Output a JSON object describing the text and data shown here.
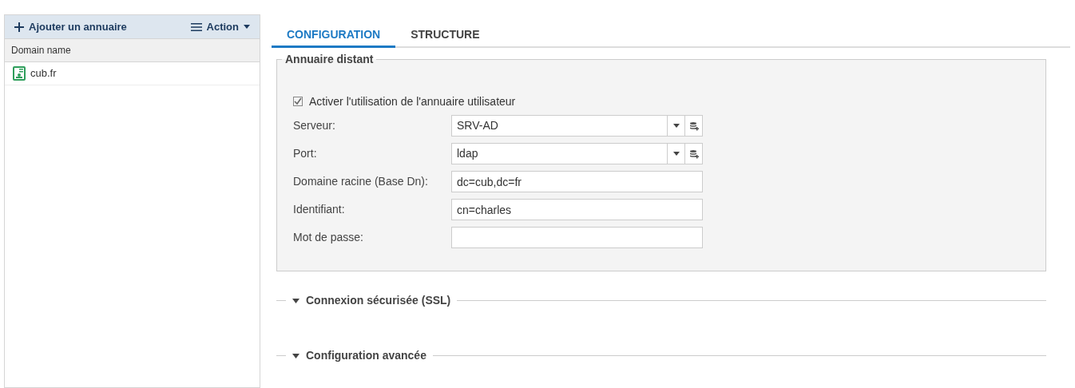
{
  "sidebar": {
    "toolbar": {
      "add_button": "Ajouter un annuaire",
      "action_button": "Action"
    },
    "column": "Domain name",
    "rows": [
      {
        "label": "cub.fr",
        "selected": false
      }
    ]
  },
  "tabs": [
    {
      "label": "CONFIGURATION",
      "selected": true
    },
    {
      "label": "STRUCTURE",
      "selected": false
    }
  ],
  "fieldset": {
    "legend": "Annuaire distant",
    "checkbox": {
      "label": "Activer l'utilisation de l'annuaire utilisateur",
      "checked": true
    },
    "fields": [
      {
        "kind": "combo",
        "label": "Serveur:",
        "value": "SRV-AD"
      },
      {
        "kind": "combo",
        "label": "Port:",
        "value": "ldap"
      },
      {
        "kind": "text",
        "label": "Domaine racine (Base Dn):",
        "value": "dc=cub,dc=fr"
      },
      {
        "kind": "text",
        "label": "Identifiant:",
        "value": "cn=charles"
      },
      {
        "kind": "password",
        "label": "Mot de passe:"
      }
    ]
  },
  "sections": [
    {
      "label": "Connexion sécurisée (SSL)",
      "expanded": false
    },
    {
      "label": "Configuration avancée",
      "expanded": false
    }
  ]
}
